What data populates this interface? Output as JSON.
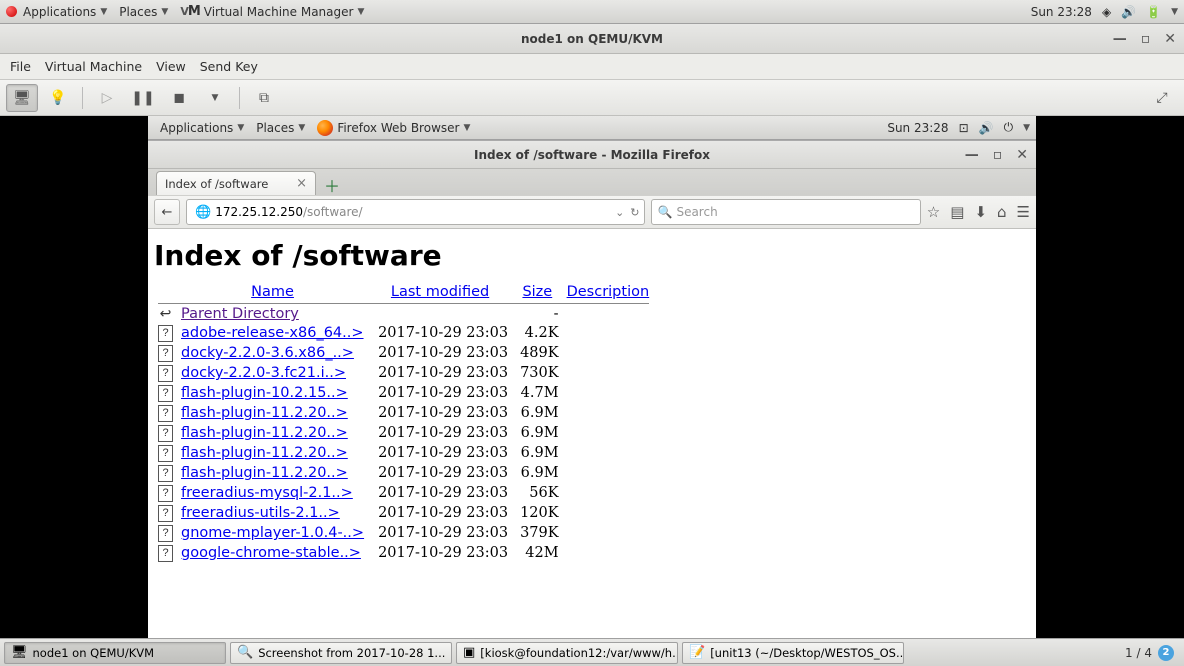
{
  "host_panel": {
    "apps": "Applications",
    "places": "Places",
    "vmm": "Virtual Machine Manager",
    "clock": "Sun 23:28"
  },
  "vmm_window": {
    "title": "node1 on QEMU/KVM",
    "menu": {
      "file": "File",
      "vm": "Virtual Machine",
      "view": "View",
      "sendkey": "Send Key"
    }
  },
  "guest_panel": {
    "apps": "Applications",
    "places": "Places",
    "ff": "Firefox Web Browser",
    "clock": "Sun 23:28"
  },
  "firefox": {
    "window_title": "Index of /software - Mozilla Firefox",
    "tab_title": "Index of /software",
    "url_host": "172.25.12.250",
    "url_path": "/software/",
    "search_placeholder": "Search"
  },
  "listing": {
    "heading": "Index of /software",
    "columns": {
      "name": "Name",
      "modified": "Last modified",
      "size": "Size",
      "desc": "Description"
    },
    "parent": {
      "label": "Parent Directory",
      "size": "-"
    },
    "rows": [
      {
        "name": "adobe-release-x86_64..>",
        "date": "2017-10-29 23:03",
        "size": "4.2K"
      },
      {
        "name": "docky-2.2.0-3.6.x86_..>",
        "date": "2017-10-29 23:03",
        "size": "489K"
      },
      {
        "name": "docky-2.2.0-3.fc21.i..>",
        "date": "2017-10-29 23:03",
        "size": "730K"
      },
      {
        "name": "flash-plugin-10.2.15..>",
        "date": "2017-10-29 23:03",
        "size": "4.7M"
      },
      {
        "name": "flash-plugin-11.2.20..>",
        "date": "2017-10-29 23:03",
        "size": "6.9M"
      },
      {
        "name": "flash-plugin-11.2.20..>",
        "date": "2017-10-29 23:03",
        "size": "6.9M"
      },
      {
        "name": "flash-plugin-11.2.20..>",
        "date": "2017-10-29 23:03",
        "size": "6.9M"
      },
      {
        "name": "flash-plugin-11.2.20..>",
        "date": "2017-10-29 23:03",
        "size": "6.9M"
      },
      {
        "name": "freeradius-mysql-2.1..>",
        "date": "2017-10-29 23:03",
        "size": "56K"
      },
      {
        "name": "freeradius-utils-2.1..>",
        "date": "2017-10-29 23:03",
        "size": "120K"
      },
      {
        "name": "gnome-mplayer-1.0.4-..>",
        "date": "2017-10-29 23:03",
        "size": "379K"
      },
      {
        "name": "google-chrome-stable..>",
        "date": "2017-10-29 23:03",
        "size": "42M"
      }
    ]
  },
  "taskbar": {
    "t1": "node1 on QEMU/KVM",
    "t2": "Screenshot from 2017-10-28 1...",
    "t3": "[kiosk@foundation12:/var/www/h...",
    "t4": "[unit13 (~/Desktop/WESTOS_OS...",
    "workspace_label": "1 / 4",
    "workspace_badge": "2"
  }
}
